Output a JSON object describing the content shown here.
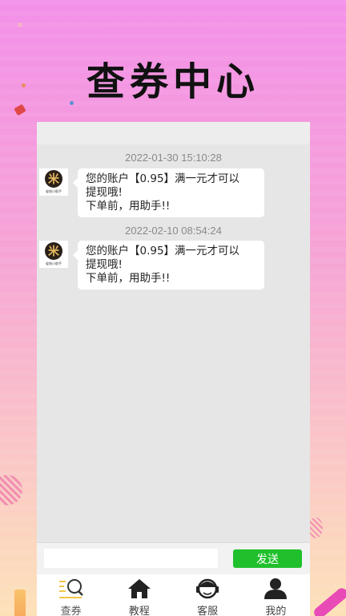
{
  "banner": {
    "title": "查券中心"
  },
  "chat": {
    "messages": [
      {
        "timestamp": "2022-01-30 15:10:28",
        "avatar_label": "米",
        "avatar_caption": "省钱小助手",
        "lines": [
          "您的账户【0.95】满一元才可以",
          "提现哦!",
          "下单前，用助手!!"
        ]
      },
      {
        "timestamp": "2022-02-10 08:54:24",
        "avatar_label": "米",
        "avatar_caption": "省钱小助手",
        "lines": [
          "您的账户【0.95】满一元才可以",
          "提现哦!",
          "下单前，用助手!!"
        ]
      }
    ]
  },
  "input": {
    "value": "",
    "placeholder": "",
    "send_label": "发送"
  },
  "tabs": [
    {
      "label": "查券",
      "icon": "search-coupon-icon",
      "active": true
    },
    {
      "label": "教程",
      "icon": "home-icon",
      "active": false
    },
    {
      "label": "客服",
      "icon": "customer-service-icon",
      "active": false
    },
    {
      "label": "我的",
      "icon": "profile-icon",
      "active": false
    }
  ],
  "colors": {
    "send": "#1fc02b",
    "chat_bg": "#e6e6e6",
    "accent_tab": "#f2c54a"
  }
}
